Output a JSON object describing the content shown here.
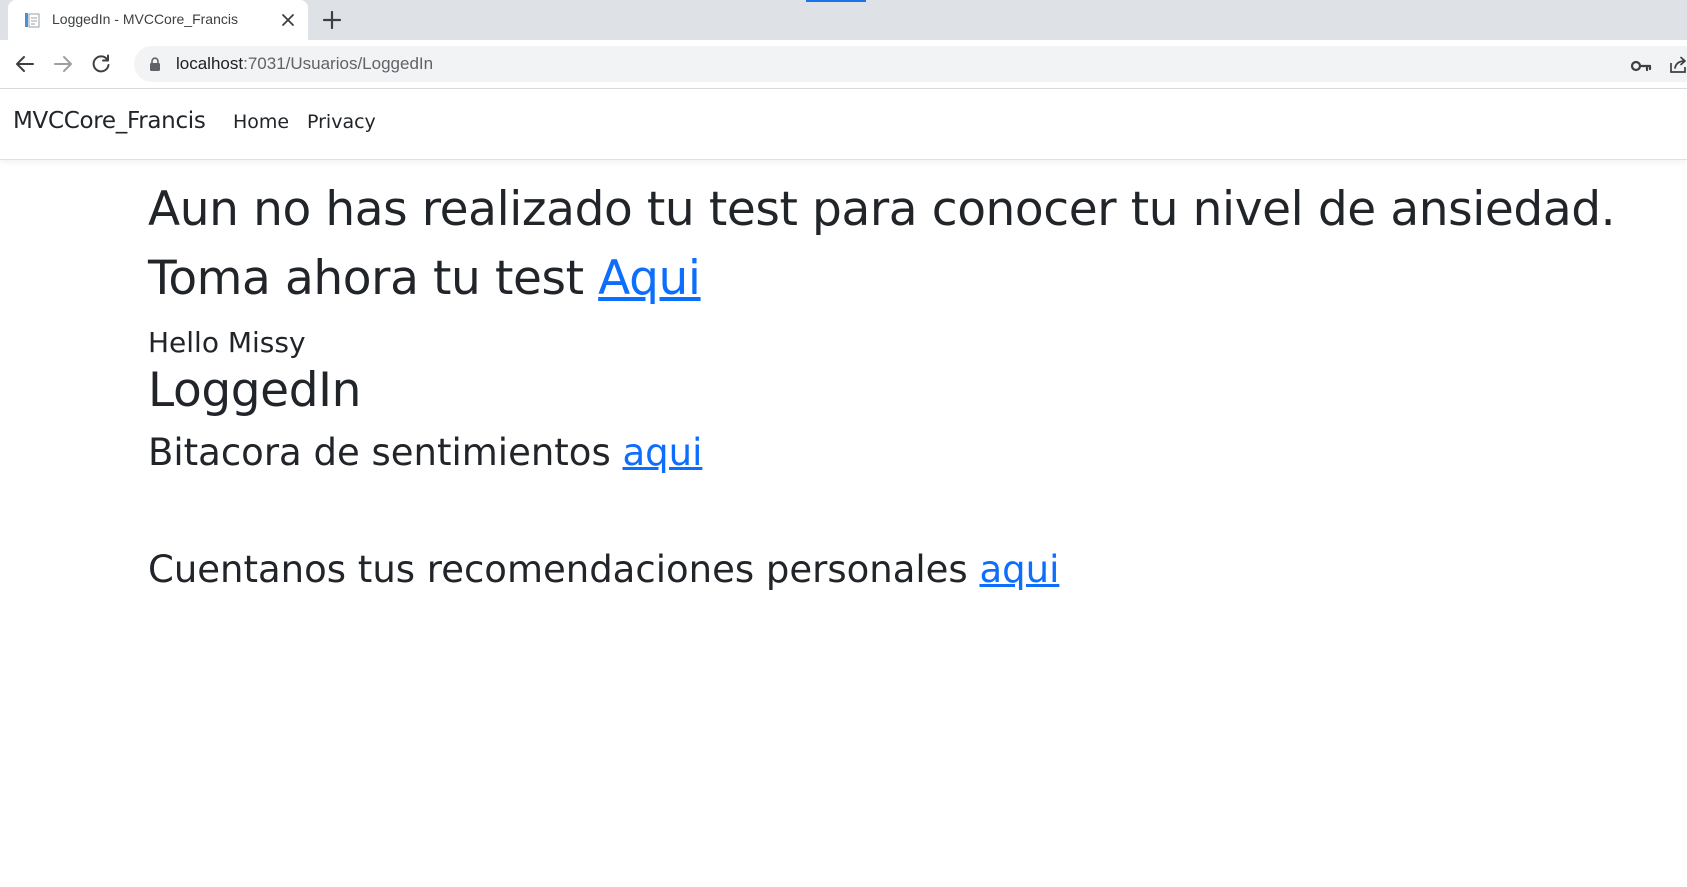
{
  "browser": {
    "tab_title": "LoggedIn - MVCCore_Francis",
    "url_host": "localhost",
    "url_rest": ":7031/Usuarios/LoggedIn"
  },
  "navbar": {
    "brand": "MVCCore_Francis",
    "links": [
      {
        "label": "Home"
      },
      {
        "label": "Privacy"
      }
    ]
  },
  "main": {
    "notice_line1": "Aun no has realizado tu test para conocer tu nivel de ansiedad.",
    "notice_line2_prefix": "Toma ahora tu test ",
    "notice_link": "Aqui",
    "greeting": "Hello Missy",
    "page_heading": "LoggedIn",
    "bitacora_prefix": "Bitacora de sentimientos ",
    "bitacora_link": "aqui",
    "recomendaciones_prefix": "Cuentanos tus recomendaciones personales ",
    "recomendaciones_link": "aqui"
  },
  "colors": {
    "link": "#0d6efd",
    "text": "#212529",
    "tabstrip": "#dee1e6",
    "omnibox": "#f1f3f4"
  },
  "icons": [
    "page-favicon-icon",
    "close-icon",
    "plus-icon",
    "back-arrow-icon",
    "forward-arrow-icon",
    "reload-icon",
    "lock-icon",
    "key-icon",
    "share-icon"
  ]
}
